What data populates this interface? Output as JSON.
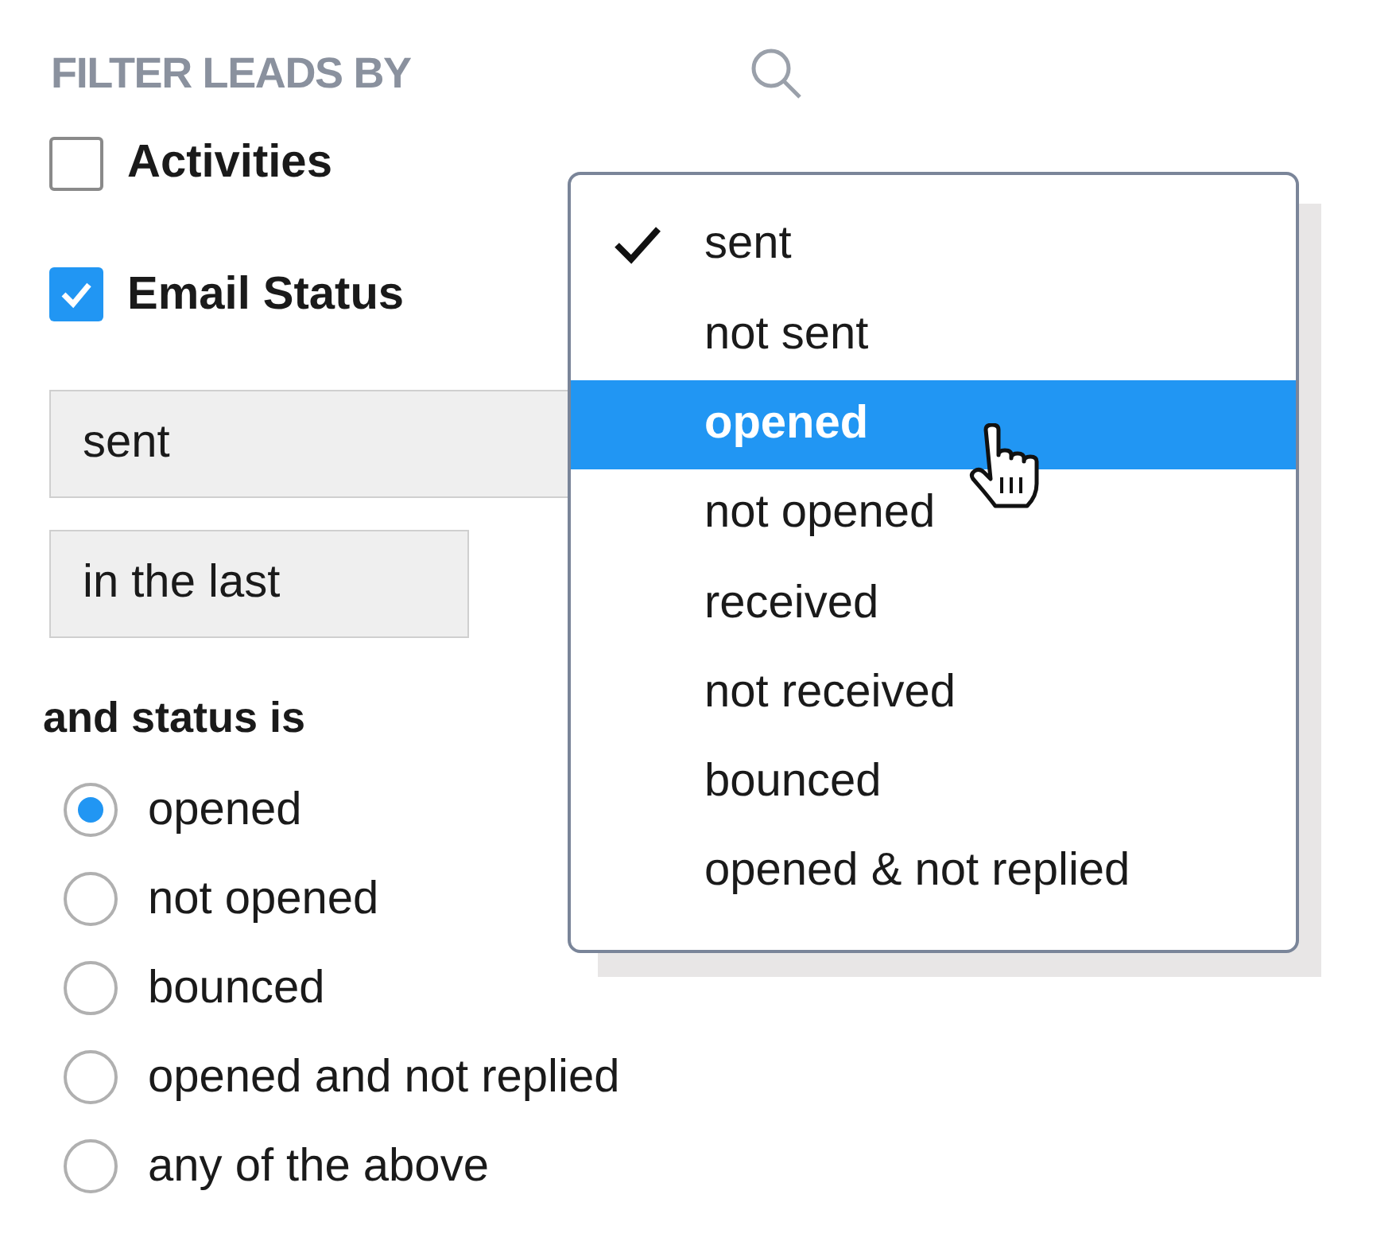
{
  "header": {
    "title": "FILTER LEADS BY"
  },
  "filters": [
    {
      "label": "Activities",
      "checked": false
    },
    {
      "label": "Email Status",
      "checked": true
    }
  ],
  "selects": [
    {
      "value": "sent"
    },
    {
      "value": "in the last"
    }
  ],
  "status": {
    "label": "and status is",
    "options": [
      {
        "label": "opened",
        "selected": true
      },
      {
        "label": "not opened",
        "selected": false
      },
      {
        "label": "bounced",
        "selected": false
      },
      {
        "label": "opened and not replied",
        "selected": false
      },
      {
        "label": "any of the above",
        "selected": false
      }
    ]
  },
  "dropdown": {
    "options": [
      {
        "label": "sent",
        "checked": true,
        "highlighted": false
      },
      {
        "label": "not sent",
        "checked": false,
        "highlighted": false
      },
      {
        "label": "opened",
        "checked": false,
        "highlighted": true
      },
      {
        "label": "not opened",
        "checked": false,
        "highlighted": false
      },
      {
        "label": "received",
        "checked": false,
        "highlighted": false
      },
      {
        "label": "not received",
        "checked": false,
        "highlighted": false
      },
      {
        "label": "bounced",
        "checked": false,
        "highlighted": false
      },
      {
        "label": "opened & not replied",
        "checked": false,
        "highlighted": false
      }
    ]
  }
}
